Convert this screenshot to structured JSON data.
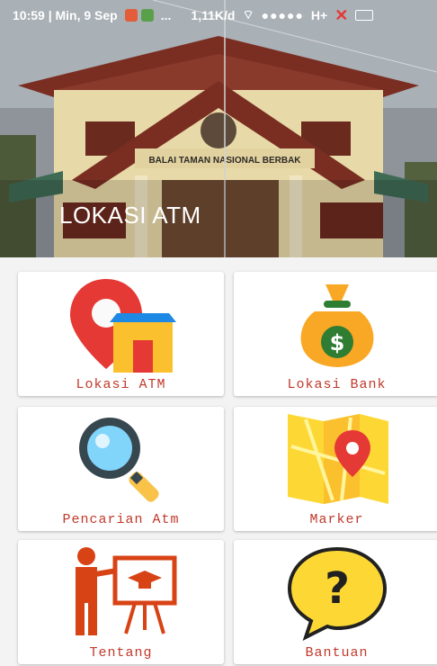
{
  "status_bar": {
    "time_date": "10:59 | Min, 9 Sep",
    "ellipsis": "...",
    "network_speed": "1,11K/d",
    "signal_dots": "●●●●●",
    "network_type": "H+"
  },
  "header": {
    "title": "LOKASI ATM",
    "building_sign": "BALAI TAMAN NASIONAL BERBAK"
  },
  "menu": [
    {
      "label": "Lokasi ATM",
      "icon": "location-pin-building-icon"
    },
    {
      "label": "Lokasi Bank",
      "icon": "money-bag-icon"
    },
    {
      "label": "Pencarian Atm",
      "icon": "magnifier-icon"
    },
    {
      "label": "Marker",
      "icon": "map-marker-icon"
    },
    {
      "label": "Tentang",
      "icon": "teacher-presentation-icon"
    },
    {
      "label": "Bantuan",
      "icon": "help-speech-bubble-icon"
    }
  ],
  "colors": {
    "label_text": "#c0392b",
    "card_bg": "#ffffff",
    "page_bg": "#f3f3f3"
  }
}
